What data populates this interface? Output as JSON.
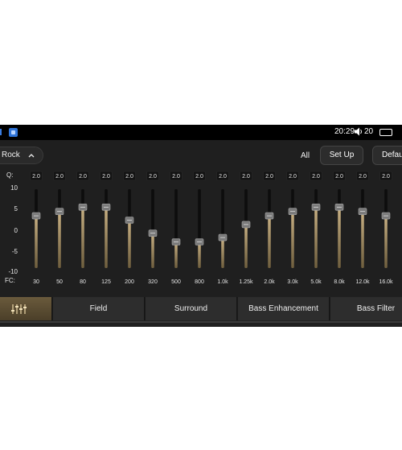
{
  "status": {
    "time": "20:29",
    "volume": "20"
  },
  "toolbar": {
    "preset": "Rock",
    "all": "All",
    "setup": "Set Up",
    "default": "Default"
  },
  "eq": {
    "q_label": "Q:",
    "fc_label": "FC:",
    "y_ticks": [
      "10",
      "5",
      "0",
      "-5",
      "-10"
    ],
    "bands": [
      {
        "q": "2.0",
        "fc": "30",
        "gain": 3.5
      },
      {
        "q": "2.0",
        "fc": "50",
        "gain": 4.5
      },
      {
        "q": "2.0",
        "fc": "80",
        "gain": 5.5
      },
      {
        "q": "2.0",
        "fc": "125",
        "gain": 5.5
      },
      {
        "q": "2.0",
        "fc": "200",
        "gain": 2.5
      },
      {
        "q": "2.0",
        "fc": "320",
        "gain": -0.5
      },
      {
        "q": "2.0",
        "fc": "500",
        "gain": -2.5
      },
      {
        "q": "2.0",
        "fc": "800",
        "gain": -2.5
      },
      {
        "q": "2.0",
        "fc": "1.0k",
        "gain": -1.5
      },
      {
        "q": "2.0",
        "fc": "1.25k",
        "gain": 1.5
      },
      {
        "q": "2.0",
        "fc": "2.0k",
        "gain": 3.5
      },
      {
        "q": "2.0",
        "fc": "3.0k",
        "gain": 4.5
      },
      {
        "q": "2.0",
        "fc": "5.0k",
        "gain": 5.5
      },
      {
        "q": "2.0",
        "fc": "8.0k",
        "gain": 5.5
      },
      {
        "q": "2.0",
        "fc": "12.0k",
        "gain": 4.5
      },
      {
        "q": "2.0",
        "fc": "16.0k",
        "gain": 3.5
      }
    ]
  },
  "tabs": [
    "Field",
    "Surround",
    "Bass Enhancement",
    "Bass Filter"
  ],
  "colors": {
    "accent": "#c9b184",
    "panel": "#1f1f1f"
  }
}
